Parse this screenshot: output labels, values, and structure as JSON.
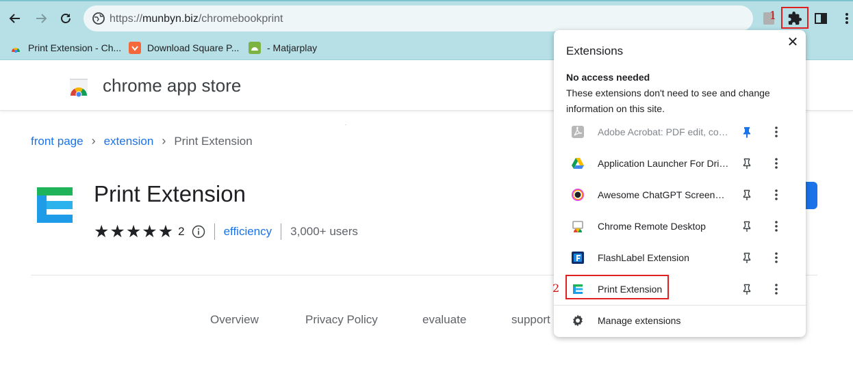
{
  "browser": {
    "url_scheme": "https://",
    "url_host": "munbyn.biz",
    "url_path": "/chromebookprint",
    "colors": {
      "toolbar": "#b6e0e6",
      "accent": "#1a73e8"
    },
    "icons": [
      "back-arrow-icon",
      "forward-arrow-icon",
      "reload-icon",
      "site-info-icon",
      "extensions-puzzle-icon",
      "side-panel-icon",
      "more-vertical-icon"
    ]
  },
  "bookmarks": [
    {
      "label": "Print Extension - Ch...",
      "icon": "chrome-webstore-icon"
    },
    {
      "label": "Download Square P...",
      "icon": "square-app-icon"
    },
    {
      "label": "- Matjarplay",
      "icon": "android-icon"
    }
  ],
  "store": {
    "title": "chrome app store"
  },
  "breadcrumb": {
    "home": "front page",
    "category": "extension",
    "current": "Print Extension"
  },
  "extension": {
    "name": "Print Extension",
    "rating": 5,
    "rating_count": "2",
    "category": "efficiency",
    "users": "3,000+ users"
  },
  "tabs": [
    "Overview",
    "Privacy Policy",
    "evaluate",
    "support"
  ],
  "popup": {
    "title": "Extensions",
    "close": "✕",
    "section_title": "No access needed",
    "section_desc": "These extensions don't need to see and change information on this site.",
    "items": [
      {
        "name": "Adobe Acrobat: PDF edit, convert, sign tools",
        "pinned": true,
        "disabled": true
      },
      {
        "name": "Application Launcher For Drive (by Google)",
        "pinned": false
      },
      {
        "name": "Awesome ChatGPT Screenshot & Screen Recorder",
        "pinned": false
      },
      {
        "name": "Chrome Remote Desktop",
        "pinned": false
      },
      {
        "name": "FlashLabel Extension",
        "pinned": false
      },
      {
        "name": "Print Extension",
        "pinned": false
      }
    ],
    "manage": "Manage extensions"
  },
  "annotations": {
    "step1": "1",
    "step2": "2"
  }
}
